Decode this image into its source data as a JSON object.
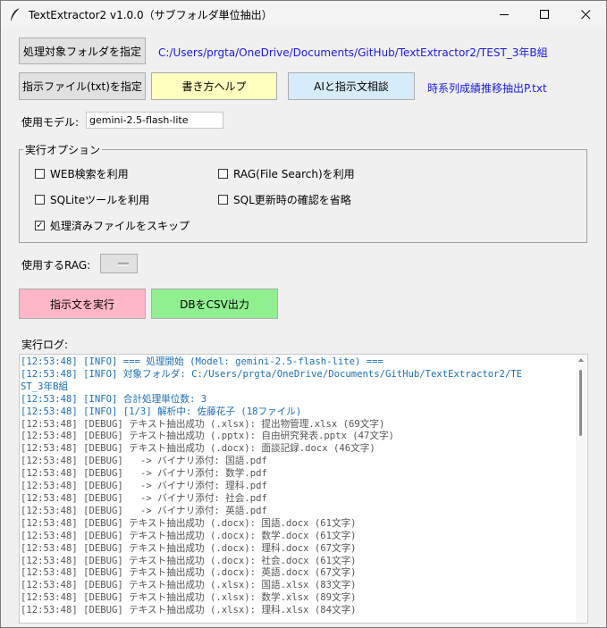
{
  "window": {
    "title": "TextExtractor2 v1.0.0（サブフォルダ単位抽出）",
    "icon": "feather-icon",
    "controls": [
      "minimize-icon",
      "maximize-icon",
      "close-icon"
    ]
  },
  "folder": {
    "button_label": "処理対象フォルダを指定",
    "path": "C:/Users/prgta/OneDrive/Documents/GitHub/TextExtractor2/TEST_3年B組"
  },
  "instruction": {
    "button_label": "指示ファイル(txt)を指定",
    "help_label": "書き方ヘルプ",
    "ai_label": "AIと指示文相談",
    "file_name": "時系列成績推移抽出P.txt"
  },
  "model": {
    "label": "使用モデル:",
    "value": "gemini-2.5-flash-lite"
  },
  "options": {
    "title": "実行オプション",
    "web_search": {
      "label": "WEB検索を利用",
      "checked": false
    },
    "rag": {
      "label": "RAG(File Search)を利用",
      "checked": false
    },
    "sqlite": {
      "label": "SQLiteツールを利用",
      "checked": false
    },
    "skip_sql_confirm": {
      "label": "SQL更新時の確認を省略",
      "checked": false
    },
    "skip_processed": {
      "label": "処理済みファイルをスキップ",
      "checked": true
    }
  },
  "rag_select": {
    "label": "使用するRAG:",
    "value": ""
  },
  "actions": {
    "run_label": "指示文を実行",
    "csv_label": "DBをCSV出力"
  },
  "log": {
    "label": "実行ログ:",
    "lines": [
      "[12:53:48] [INFO] === 処理開始 (Model: gemini-2.5-flash-lite) ===",
      "[12:53:48] [INFO] 対象フォルダ: C:/Users/prgta/OneDrive/Documents/GitHub/TextExtractor2/TE",
      "ST_3年B組",
      "[12:53:48] [INFO] 合計処理単位数: 3",
      "[12:53:48] [INFO] [1/3] 解析中: 佐藤花子 (18ファイル)",
      "[12:53:48] [DEBUG] テキスト抽出成功 (.xlsx): 提出物管理.xlsx (69文字)",
      "[12:53:48] [DEBUG] テキスト抽出成功 (.pptx): 自由研究発表.pptx (47文字)",
      "[12:53:48] [DEBUG] テキスト抽出成功 (.docx): 面談記録.docx (46文字)",
      "[12:53:48] [DEBUG]   -> バイナリ添付: 国語.pdf",
      "[12:53:48] [DEBUG]   -> バイナリ添付: 数学.pdf",
      "[12:53:48] [DEBUG]   -> バイナリ添付: 理科.pdf",
      "[12:53:48] [DEBUG]   -> バイナリ添付: 社会.pdf",
      "[12:53:48] [DEBUG]   -> バイナリ添付: 英語.pdf",
      "[12:53:48] [DEBUG] テキスト抽出成功 (.docx): 国語.docx (61文字)",
      "[12:53:48] [DEBUG] テキスト抽出成功 (.docx): 数学.docx (61文字)",
      "[12:53:48] [DEBUG] テキスト抽出成功 (.docx): 理科.docx (67文字)",
      "[12:53:48] [DEBUG] テキスト抽出成功 (.docx): 社会.docx (61文字)",
      "[12:53:48] [DEBUG] テキスト抽出成功 (.docx): 英語.docx (67文字)",
      "[12:53:48] [DEBUG] テキスト抽出成功 (.xlsx): 国語.xlsx (83文字)",
      "[12:53:48] [DEBUG] テキスト抽出成功 (.xlsx): 数学.xlsx (89文字)",
      "[12:53:48] [DEBUG] テキスト抽出成功 (.xlsx): 理科.xlsx (84文字)"
    ],
    "colors": {
      "INFO": "#1a6fb5",
      "DEBUG": "#555555"
    }
  },
  "colors": {
    "help_button": "#ffffc0",
    "ai_button": "#d6ecfa",
    "run_button": "#ffb6c8",
    "csv_button": "#90f090",
    "link_text": "#1a1ae6"
  }
}
